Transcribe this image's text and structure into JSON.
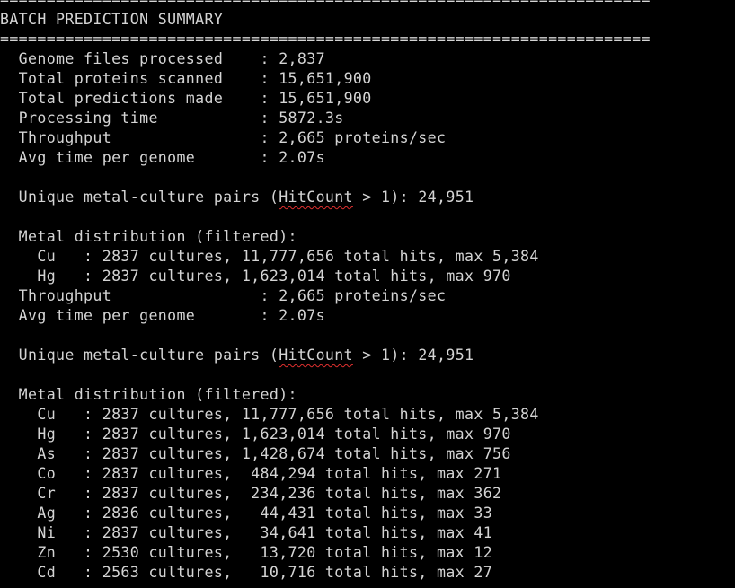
{
  "colors": {
    "background": "#000000",
    "foreground": "#d4d4d4",
    "spellcheck_underline": "#e0302f"
  },
  "lines": [
    "======================================================================",
    "BATCH PREDICTION SUMMARY",
    "======================================================================",
    "  Genome files processed    : 2,837",
    "  Total proteins scanned    : 15,651,900",
    "  Total predictions made    : 15,651,900",
    "  Processing time           : 5872.3s",
    "  Throughput                : 2,665 proteins/sec",
    "  Avg time per genome       : 2.07s",
    "",
    "  Unique metal-culture pairs (",
    "  Metal distribution (filtered):",
    "    Cu   : 2837 cultures, 11,777,656 total hits, max 5,384",
    "    Hg   : 2837 cultures, 1,623,014 total hits, max 970",
    "  Throughput                : 2,665 proteins/sec",
    "  Avg time per genome       : 2.07s",
    "",
    "  Unique metal-culture pairs (",
    "  Metal distribution (filtered):",
    "    Cu   : 2837 cultures, 11,777,656 total hits, max 5,384",
    "    Hg   : 2837 cultures, 1,623,014 total hits, max 970",
    "    As   : 2837 cultures, 1,428,674 total hits, max 756",
    "    Co   : 2837 cultures,  484,294 total hits, max 271",
    "    Cr   : 2837 cultures,  234,236 total hits, max 362",
    "    Ag   : 2836 cultures,   44,431 total hits, max 33",
    "    Ni   : 2837 cultures,   34,641 total hits, max 41",
    "    Zn   : 2530 cultures,   13,720 total hits, max 12",
    "    Cd   : 2563 cultures,   10,716 total hits, max 27"
  ],
  "unique_pairs": {
    "prefix": "  Unique metal-culture pairs (",
    "keyword": "HitCount",
    "suffix": " > 1): 24,951"
  }
}
